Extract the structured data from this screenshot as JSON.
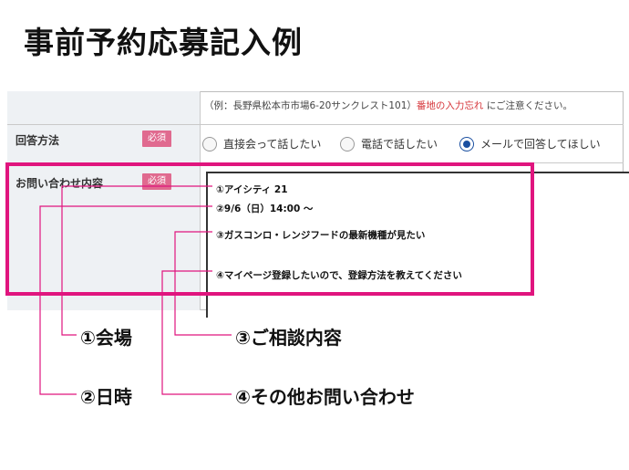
{
  "page_title": "事前予約応募記入例",
  "form": {
    "example_note_prefix": "（例：長野県松本市市場6-20サンクレスト101）",
    "example_note_warning": "番地の入力忘れ",
    "example_note_suffix": "にご注意ください。",
    "contact_method": {
      "label": "回答方法",
      "required_badge": "必須",
      "options": [
        {
          "label": "直接会って話したい",
          "selected": false
        },
        {
          "label": "電話で話したい",
          "selected": false
        },
        {
          "label": "メールで回答してほしい",
          "selected": true
        }
      ]
    },
    "inquiry": {
      "label": "お問い合わせ内容",
      "required_badge": "必須",
      "lines": [
        "①アイシティ 21",
        "②9/6（日）14:00 〜",
        "③ガスコンロ・レンジフードの最新機種が見たい",
        "④マイページ登録したいので、登録方法を教えてください"
      ]
    }
  },
  "callouts": [
    {
      "label": "①会場"
    },
    {
      "label": "②日時"
    },
    {
      "label": "③ご相談内容"
    },
    {
      "label": "④その他お問い合わせ"
    }
  ],
  "colors": {
    "highlight": "#e0157e",
    "required_badge": "#e06a8f",
    "warning_text": "#d6373c",
    "radio_selected": "#1a4fa0"
  }
}
